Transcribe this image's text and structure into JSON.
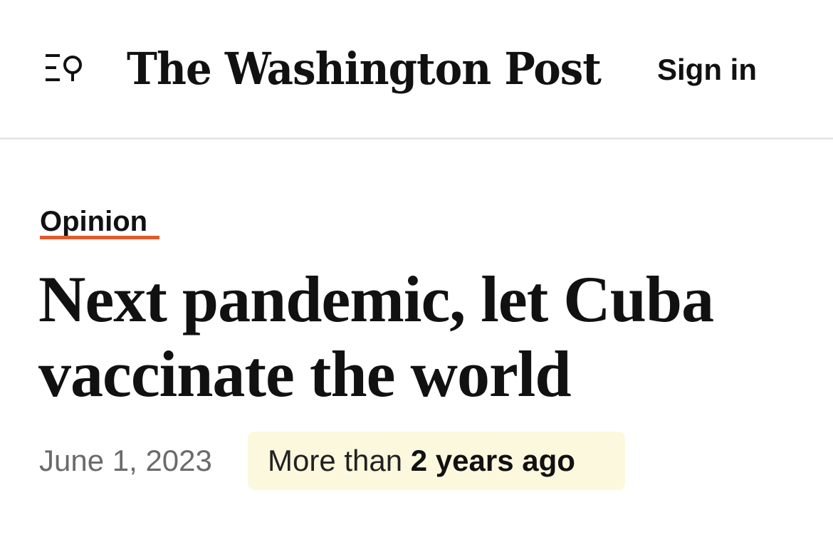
{
  "header": {
    "masthead": "The Washington Post",
    "sign_in_label": "Sign in",
    "menu_icon": "menu-search-icon"
  },
  "article": {
    "section": "Opinion",
    "headline": "Next pandemic, let Cuba vaccinate the world",
    "date": "June 1, 2023",
    "age_prefix": "More than ",
    "age_value": "2 years ago"
  },
  "colors": {
    "section_underline": "#e05a2b",
    "age_badge_background": "#fbf8dd",
    "date_text": "#6b6b6b"
  }
}
